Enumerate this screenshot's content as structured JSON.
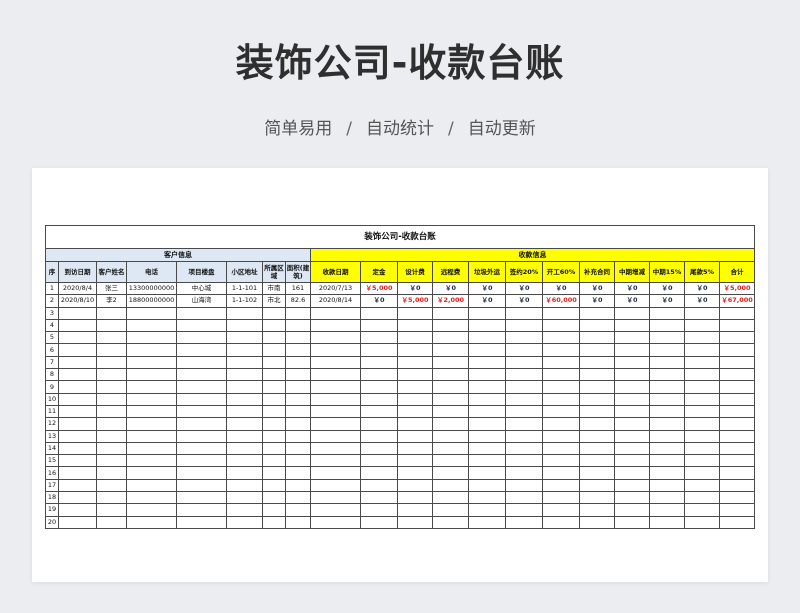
{
  "page": {
    "title": "装饰公司-收款台账",
    "subtitle": [
      "简单易用",
      "自动统计",
      "自动更新"
    ],
    "separator": "/"
  },
  "sheet": {
    "title": "装饰公司-收款台账",
    "groups": {
      "customer": "客户信息",
      "payment": "收款信息"
    },
    "headers": [
      "序",
      "到访日期",
      "客户姓名",
      "电话",
      "项目楼盘",
      "小区地址",
      "所属区域",
      "面积(建筑)",
      "收款日期",
      "定金",
      "设计费",
      "远程费",
      "垃圾外运",
      "签约20%",
      "开工60%",
      "补充合同",
      "中期增减",
      "中期15%",
      "尾款5%",
      "合计"
    ],
    "rows": [
      {
        "no": "1",
        "visit_date": "2020/8/4",
        "name": "张三",
        "phone": "13300000000",
        "project": "中心城",
        "address": "1-1-101",
        "area": "市南",
        "size": "161",
        "pay_date": "2020/7/13",
        "money": [
          {
            "v": "￥5,000",
            "red": true
          },
          {
            "v": "￥0",
            "red": false
          },
          {
            "v": "￥0",
            "red": false
          },
          {
            "v": "￥0",
            "red": false
          },
          {
            "v": "￥0",
            "red": false
          },
          {
            "v": "￥0",
            "red": false
          },
          {
            "v": "￥0",
            "red": false
          },
          {
            "v": "￥0",
            "red": false
          },
          {
            "v": "￥0",
            "red": false
          },
          {
            "v": "￥0",
            "red": false
          },
          {
            "v": "￥5,000",
            "red": true
          }
        ]
      },
      {
        "no": "2",
        "visit_date": "2020/8/10",
        "name": "李2",
        "phone": "18800000000",
        "project": "山海湾",
        "address": "1-1-102",
        "area": "市北",
        "size": "82.6",
        "pay_date": "2020/8/14",
        "money": [
          {
            "v": "￥0",
            "red": false
          },
          {
            "v": "￥5,000",
            "red": true
          },
          {
            "v": "￥2,000",
            "red": true
          },
          {
            "v": "￥0",
            "red": false
          },
          {
            "v": "￥0",
            "red": false
          },
          {
            "v": "￥60,000",
            "red": true
          },
          {
            "v": "￥0",
            "red": false
          },
          {
            "v": "￥0",
            "red": false
          },
          {
            "v": "￥0",
            "red": false
          },
          {
            "v": "￥0",
            "red": false
          },
          {
            "v": "￥67,000",
            "red": true
          }
        ]
      }
    ],
    "empty_row_numbers": [
      "3",
      "4",
      "5",
      "6",
      "7",
      "8",
      "9",
      "10",
      "11",
      "12",
      "13",
      "14",
      "15",
      "16",
      "17",
      "18",
      "19",
      "20"
    ]
  },
  "colors": {
    "customer_header": "#dde8f4",
    "payment_header": "#ffff00",
    "money_red": "#e0201c",
    "money_dark": "#1f2a44"
  }
}
